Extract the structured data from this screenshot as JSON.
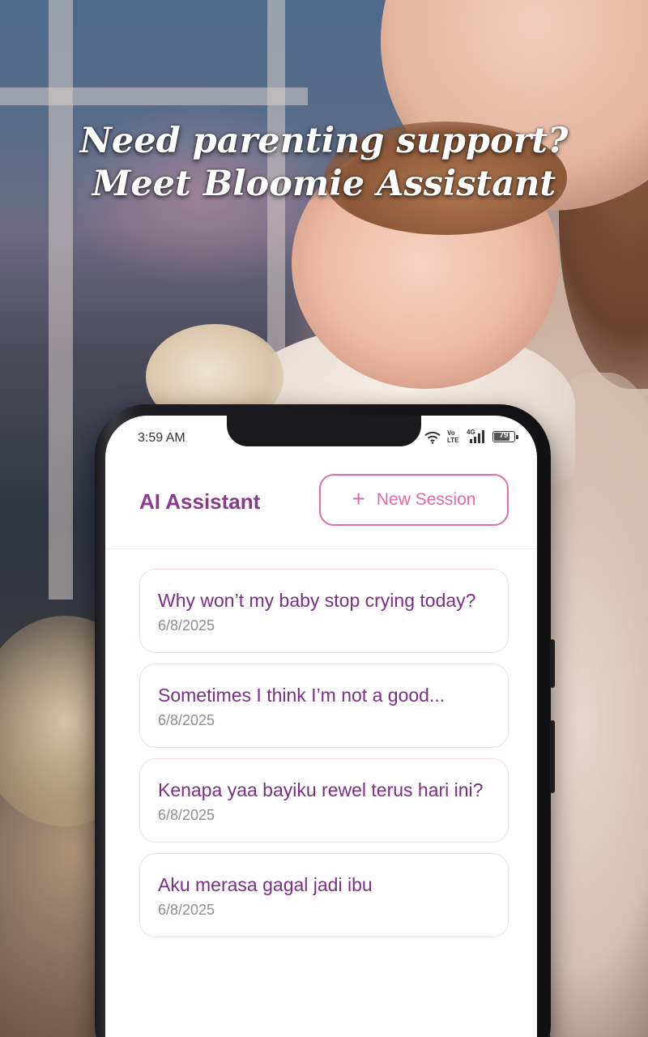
{
  "headline": {
    "line1": "Need parenting support?",
    "line2": "Meet Bloomie Assistant"
  },
  "status_bar": {
    "time": "3:59 AM",
    "network_vo": "Vo",
    "network_lte": "LTE",
    "network_gen": "4G",
    "battery": "79"
  },
  "app": {
    "title": "AI Assistant",
    "new_session_label": "New Session",
    "accent_color": "#8a3a8a",
    "button_color": "#e06aa6"
  },
  "sessions": [
    {
      "title": "Why won’t my baby stop crying today?",
      "date": "6/8/2025"
    },
    {
      "title": "Sometimes I think I’m not a good...",
      "date": "6/8/2025"
    },
    {
      "title": "Kenapa yaa bayiku rewel terus hari ini?",
      "date": "6/8/2025"
    },
    {
      "title": "Aku merasa gagal jadi ibu",
      "date": "6/8/2025"
    }
  ]
}
